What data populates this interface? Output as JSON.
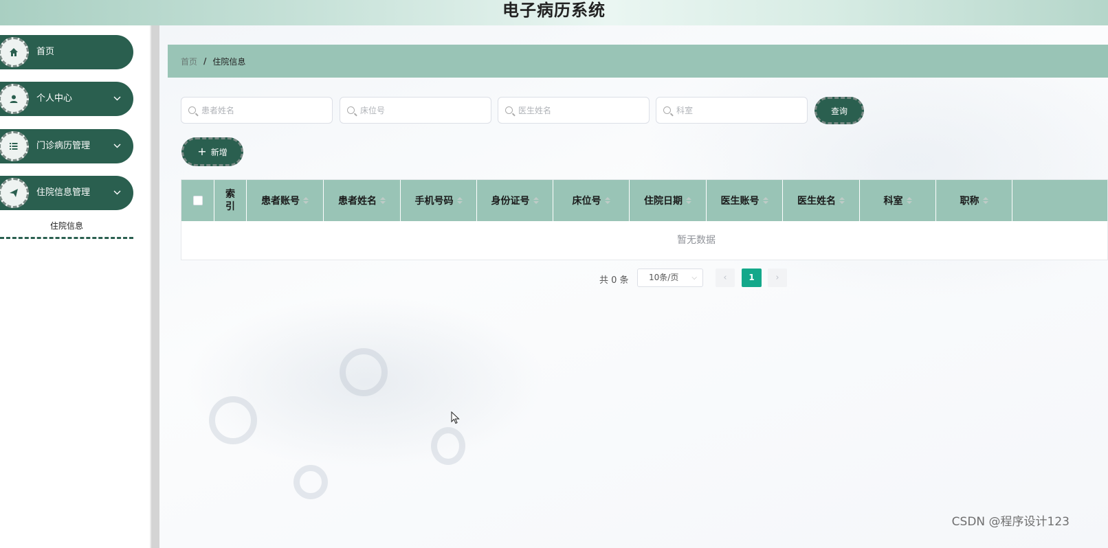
{
  "header": {
    "title": "电子病历系统"
  },
  "sidebar": {
    "items": [
      {
        "label": "首页",
        "icon": "home-icon",
        "has_arrow": false
      },
      {
        "label": "个人中心",
        "icon": "user-icon",
        "has_arrow": true
      },
      {
        "label": "门诊病历管理",
        "icon": "list-icon",
        "has_arrow": true
      },
      {
        "label": "住院信息管理",
        "icon": "send-icon",
        "has_arrow": true
      }
    ],
    "submenu": {
      "label": "住院信息"
    }
  },
  "breadcrumb": {
    "home": "首页",
    "separator": "/",
    "current": "住院信息"
  },
  "search": {
    "fields": [
      {
        "placeholder": "患者姓名"
      },
      {
        "placeholder": "床位号"
      },
      {
        "placeholder": "医生姓名"
      },
      {
        "placeholder": "科室"
      }
    ],
    "query_label": "查询"
  },
  "actions": {
    "add_label": "新增"
  },
  "table": {
    "columns": [
      "索引",
      "患者账号",
      "患者姓名",
      "手机号码",
      "身份证号",
      "床位号",
      "住院日期",
      "医生账号",
      "医生姓名",
      "科室",
      "职称"
    ],
    "empty_text": "暂无数据"
  },
  "pagination": {
    "total_text": "共 0 条",
    "page_size": "10条/页",
    "current_page": "1",
    "prev": "‹",
    "next": "›"
  },
  "watermark": "CSDN @程序设计123",
  "colors": {
    "primary": "#2a5f4f",
    "header_bg": "#99c4b6",
    "active_page": "#14a88a"
  }
}
